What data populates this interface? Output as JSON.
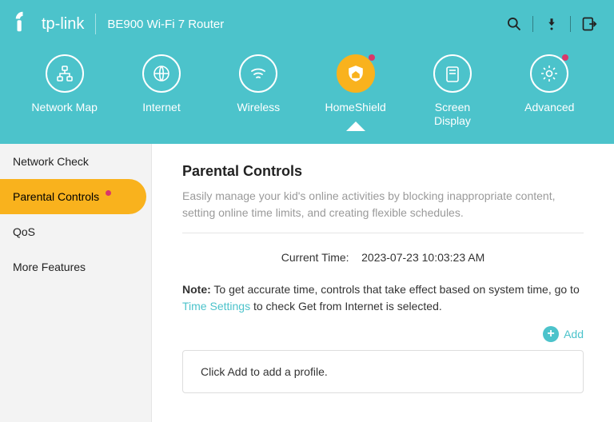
{
  "header": {
    "brand": "tp-link",
    "product": "BE900 Wi-Fi 7 Router"
  },
  "tabs": [
    {
      "label": "Network Map"
    },
    {
      "label": "Internet"
    },
    {
      "label": "Wireless"
    },
    {
      "label": "HomeShield",
      "active": true,
      "dot": true
    },
    {
      "label": "Screen Display"
    },
    {
      "label": "Advanced",
      "dot": true
    }
  ],
  "sidebar": {
    "items": [
      {
        "label": "Network Check"
      },
      {
        "label": "Parental Controls",
        "active": true,
        "dot": true
      },
      {
        "label": "QoS"
      },
      {
        "label": "More Features"
      }
    ]
  },
  "page": {
    "title": "Parental Controls",
    "description": "Easily manage your kid's online activities by blocking inappropriate content, setting online time limits, and creating flexible schedules.",
    "current_time_label": "Current Time:",
    "current_time_value": "2023-07-23 10:03:23 AM",
    "note_prefix": "Note:",
    "note_text_before": "To get accurate time, controls that take effect based on system time, go to ",
    "note_link": "Time Settings",
    "note_text_after": " to check Get from Internet is selected.",
    "add_label": "Add",
    "empty_profile_hint": "Click Add to add a profile."
  }
}
